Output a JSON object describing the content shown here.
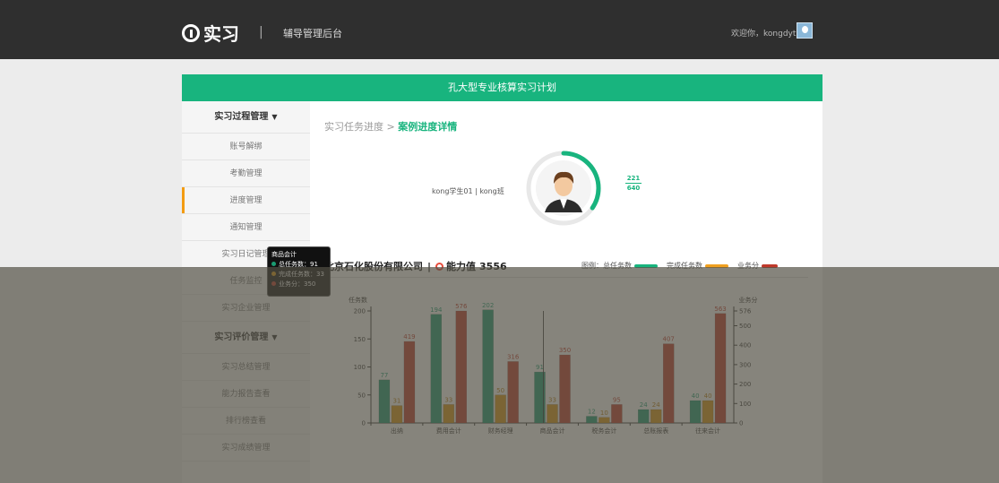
{
  "header": {
    "logo_text": "实习",
    "separator": "|",
    "system_title": "辅导管理后台",
    "welcome": "欢迎你，kongdyt"
  },
  "banner": {
    "title": "孔大型专业核算实习计划"
  },
  "sidebar": {
    "items": [
      {
        "label": "实习过程管理",
        "type": "header",
        "caret": "▼"
      },
      {
        "label": "账号解绑",
        "type": "item"
      },
      {
        "label": "考勤管理",
        "type": "item"
      },
      {
        "label": "进度管理",
        "type": "item",
        "active": true
      },
      {
        "label": "通知管理",
        "type": "item"
      },
      {
        "label": "实习日记管理",
        "type": "item"
      },
      {
        "label": "任务监控",
        "type": "item"
      },
      {
        "label": "实习企业管理",
        "type": "item"
      },
      {
        "label": "实习评价管理",
        "type": "header",
        "caret": "▼"
      },
      {
        "label": "实习总结管理",
        "type": "item"
      },
      {
        "label": "能力报告查看",
        "type": "item"
      },
      {
        "label": "排行榜查看",
        "type": "item"
      },
      {
        "label": "实习成绩管理",
        "type": "item"
      }
    ]
  },
  "breadcrumb": {
    "parent": "实习任务进度",
    "sep": " > ",
    "current": "案例进度详情"
  },
  "student": {
    "name": "kong学生01 | kong班",
    "progress_num": "221",
    "progress_den": "640",
    "progress_fraction": 0.345
  },
  "company": {
    "name": "北京石化股份有限公司",
    "sep": "|",
    "ability_label": "能力值",
    "ability_value": "3556"
  },
  "legend": {
    "prefix": "图例：",
    "total": "总任务数",
    "done": "完成任务数",
    "score": "业务分"
  },
  "colors": {
    "accent": "#18b47e",
    "total": "#1a9c72",
    "done": "#d99410",
    "score": "#c0392b",
    "ring": "#18b47e"
  },
  "chart_data": {
    "type": "bar",
    "categories": [
      "出纳",
      "费用会计",
      "财务经理",
      "商品会计",
      "税务会计",
      "总账报表",
      "往来会计"
    ],
    "series": [
      {
        "name": "总任务数",
        "axis": "left",
        "values": [
          77,
          194,
          202,
          91,
          12,
          24,
          40
        ]
      },
      {
        "name": "完成任务数",
        "axis": "left",
        "values": [
          31,
          33,
          50,
          33,
          10,
          24,
          40
        ]
      },
      {
        "name": "业务分",
        "axis": "right",
        "values": [
          419,
          576,
          316,
          350,
          95,
          407,
          563
        ]
      }
    ],
    "ylabel": "任务数",
    "y2label": "业务分",
    "ylim": [
      0,
      200
    ],
    "y2lim": [
      0,
      576
    ],
    "yticks": [
      "0",
      "50",
      "100",
      "150",
      "200"
    ],
    "y2ticks": [
      "0",
      "100",
      "200",
      "300",
      "400",
      "500",
      "576"
    ]
  },
  "tooltip": {
    "title": "商品会计",
    "total": "总任务数：91",
    "done": "完成任务数：33",
    "score": "业务分：350"
  }
}
